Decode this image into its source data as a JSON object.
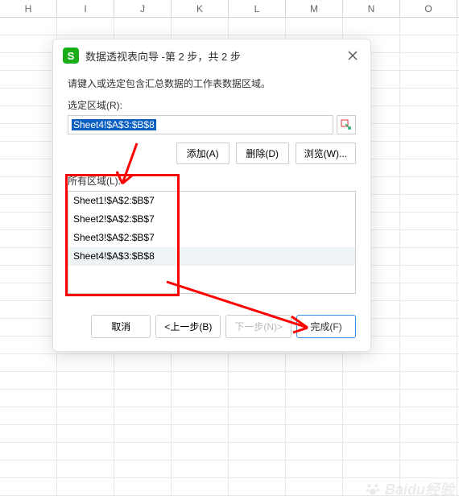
{
  "columns": [
    "H",
    "I",
    "J",
    "K",
    "L",
    "M",
    "N",
    "O"
  ],
  "dialog": {
    "title": "数据透视表向导 -第 2 步，共 2 步",
    "prompt": "请键入或选定包含汇总数据的工作表数据区域。",
    "selected_label": "选定区域(R):",
    "selected_value": "Sheet4!$A$3:$B$8",
    "add_label": "添加(A)",
    "delete_label": "删除(D)",
    "browse_label": "浏览(W)...",
    "all_label": "所有区域(L):",
    "items": [
      "Sheet1!$A$2:$B$7",
      "Sheet2!$A$2:$B$7",
      "Sheet3!$A$2:$B$7",
      "Sheet4!$A$3:$B$8"
    ],
    "selected_index": 3,
    "cancel": "取消",
    "back": "<上一步(B)",
    "next": "下一步(N)>",
    "finish": "完成(F)"
  },
  "watermark": "Baidu经验"
}
